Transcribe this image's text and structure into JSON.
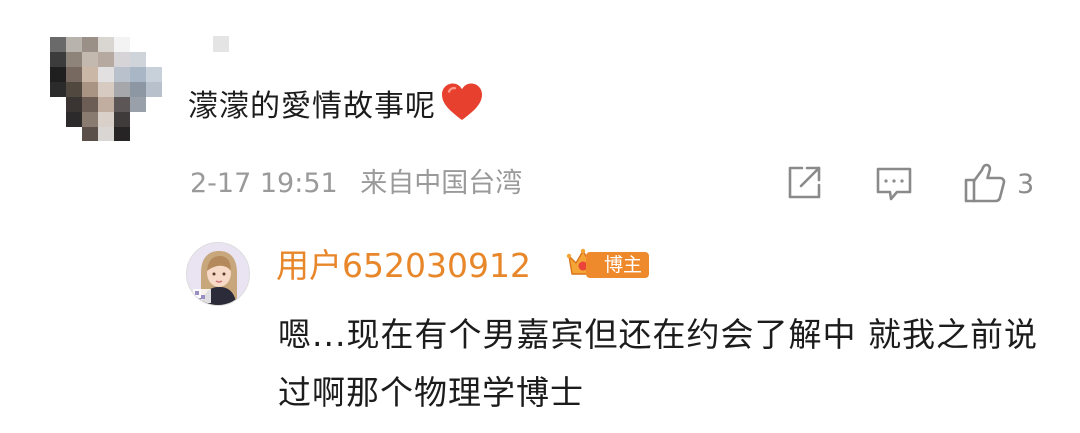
{
  "comment": {
    "text": "濛濛的愛情故事呢",
    "heart_color": "#e8402f",
    "time": "2-17 19:51",
    "location": "来自中国台湾",
    "like_count": "3",
    "icons": [
      "share-icon",
      "reply-icon",
      "like-icon"
    ]
  },
  "reply": {
    "username": "用户652030912",
    "badge_label": "博主",
    "text": "嗯...现在有个男嘉宾但还在约会了解中 就我之前说过啊那个物理学博士",
    "username_color": "#e8862a",
    "badge_color": "#ef8a2c"
  }
}
